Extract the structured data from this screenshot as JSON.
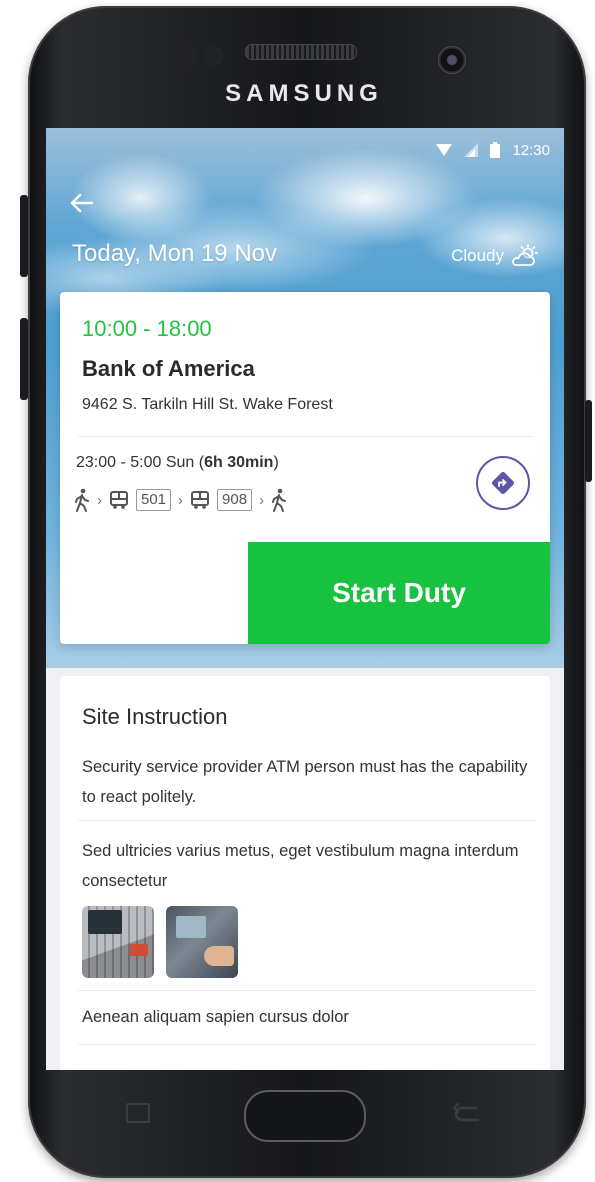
{
  "device": {
    "brand": "SAMSUNG"
  },
  "status_bar": {
    "time": "12:30"
  },
  "header": {
    "date": "Today, Mon 19 Nov",
    "weather": "Cloudy"
  },
  "duty": {
    "time_range": "10:00 - 18:00",
    "site_name": "Bank of America",
    "address": "9462 S. Tarkiln Hill St. Wake Forest",
    "route_time": "23:00 - 5:00 Sun (",
    "route_duration": "6h 30min",
    "route_time_end": ")",
    "route_buses": [
      "501",
      "908"
    ],
    "start_label": "Start Duty"
  },
  "instruction": {
    "title": "Site Instruction",
    "items": [
      "Security service provider ATM person must has the capability to react politely.",
      "Sed ultricies varius metus, eget vestibulum magna interdum consectetur",
      "Aenean aliquam sapien cursus dolor"
    ]
  },
  "colors": {
    "accent_green": "#16c240",
    "time_green": "#22c343",
    "nav_purple": "#5c55a8"
  }
}
